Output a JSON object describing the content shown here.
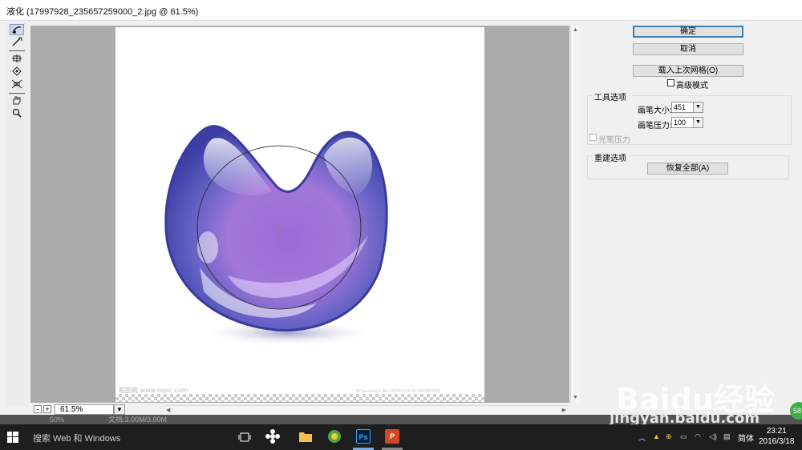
{
  "window": {
    "title": "液化 (17997928_235657259000_2.jpg @ 61.5%)"
  },
  "zoom": {
    "value": "61.5%",
    "minus": "-",
    "plus": "+"
  },
  "buttons": {
    "ok": "确定",
    "cancel": "取消",
    "load_mesh": "载入上次网格(O)",
    "restore_all": "恢复全部(A)"
  },
  "advanced_mode_label": "高级模式",
  "tool_options": {
    "title": "工具选项",
    "brush_size_label": "画笔大小:",
    "brush_size_value": "451",
    "brush_pressure_label": "画笔压力:",
    "brush_pressure_value": "100",
    "stylus_pressure_label": "光笔压力"
  },
  "reconstruct": {
    "title": "重建选项"
  },
  "document": {
    "watermark_left": "昵图网 www.nipic.com",
    "watermark_right": "BY:we-kaoji1 No:20160229121542007000"
  },
  "ps_status": {
    "zoom": "50%",
    "doc": "文档:3.00M/3.00M"
  },
  "taskbar": {
    "search_placeholder": "搜索 Web 和 Windows",
    "ime": "简体",
    "time": "23:21",
    "date": "2016/3/18",
    "ps_label": "Ps",
    "ppt_label": "P"
  },
  "watermark": {
    "baidu": "Baidu经验",
    "site": "jingyan.baidu.com",
    "badge": "58"
  },
  "colors": {
    "primary_border": "#3c7fb1",
    "canvas_bg": "#ababab",
    "taskbar_bg": "#1e1e1e",
    "ps_blue": "#2b5ba8",
    "ppt_orange": "#d24726"
  }
}
